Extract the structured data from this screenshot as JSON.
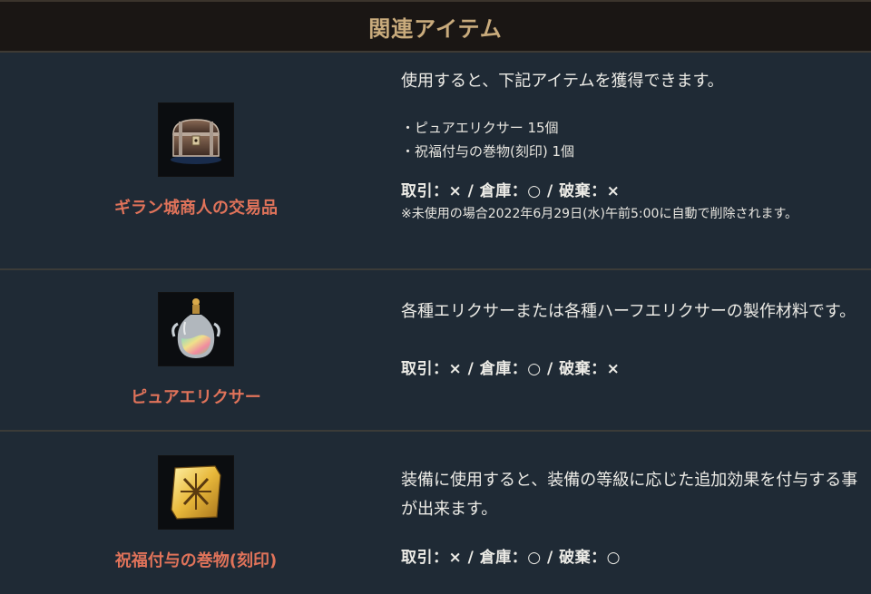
{
  "header": {
    "title": "関連アイテム"
  },
  "items": [
    {
      "name": "ギラン城商人の交易品",
      "icon": "treasure-chest-icon",
      "description": "使用すると、下記アイテムを獲得できます。",
      "bullets": [
        "・ピュアエリクサー 15個",
        "・祝福付与の巻物(刻印) 1個"
      ],
      "status": "取引：× / 倉庫：○ / 破棄：×",
      "note": "※未使用の場合2022年6月29日(水)午前5:00に自動で削除されます。"
    },
    {
      "name": "ピュアエリクサー",
      "icon": "elixir-flask-icon",
      "description": "各種エリクサーまたは各種ハーフエリクサーの製作材料です。",
      "status": "取引：× / 倉庫：○ / 破棄：×"
    },
    {
      "name": "祝福付与の巻物(刻印)",
      "icon": "scroll-icon",
      "description": "装備に使用すると、装備の等級に応じた追加効果を付与する事が出来ます。",
      "status": "取引：× / 倉庫：○ / 破棄：○"
    }
  ]
}
